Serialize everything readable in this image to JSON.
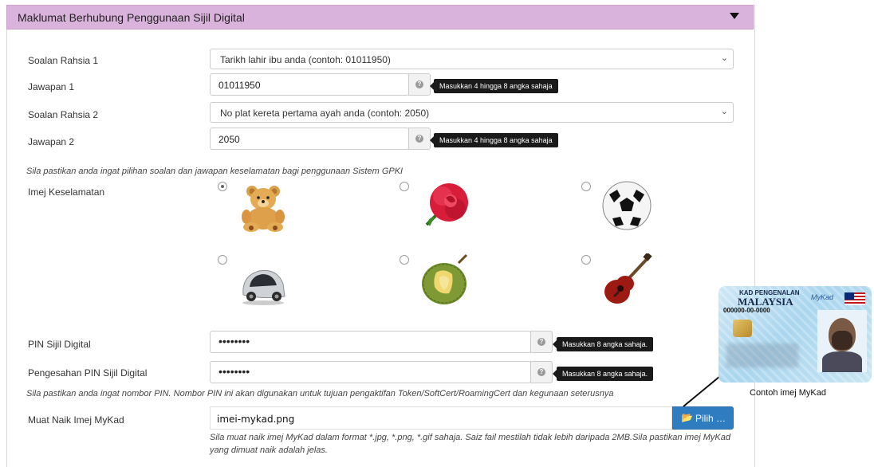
{
  "panel": {
    "title": "Maklumat Berhubung Penggunaan Sijil Digital",
    "caret_icon": "caret-down-icon"
  },
  "form": {
    "q1": {
      "label": "Soalan Rahsia 1",
      "value": "Tarikh lahir ibu anda (contoh: 01011950)"
    },
    "a1": {
      "label": "Jawapan 1",
      "value": "01011950",
      "tip": "Masukkan 4 hingga 8 angka sahaja"
    },
    "q2": {
      "label": "Soalan Rahsia 2",
      "value": "No plat kereta pertama ayah anda (contoh: 2050)"
    },
    "a2": {
      "label": "Jawapan 2",
      "value": "2050",
      "tip": "Masukkan 4 hingga 8 angka sahaja"
    },
    "security_note": "Sila pastikan anda ingat pilihan soalan dan jawapan keselamatan bagi penggunaan Sistem GPKI",
    "image_label": "Imej Keselamatan",
    "images": [
      {
        "icon": "teddy-bear-icon",
        "selected": true
      },
      {
        "icon": "rose-icon",
        "selected": false
      },
      {
        "icon": "soccer-ball-icon",
        "selected": false
      },
      {
        "icon": "car-icon",
        "selected": false
      },
      {
        "icon": "durian-icon",
        "selected": false
      },
      {
        "icon": "guitar-icon",
        "selected": false
      }
    ],
    "pin": {
      "label": "PIN Sijil Digital",
      "value": "••••••••",
      "tip": "Masukkan 8 angka sahaja."
    },
    "pin_confirm": {
      "label": "Pengesahan PIN Sijil Digital",
      "value": "••••••••",
      "tip": "Masukkan 8 angka sahaja."
    },
    "pin_note": "Sila pastikan anda ingat nombor PIN. Nombor PIN ini akan digunakan untuk tujuan pengaktifan Token/SoftCert/RoamingCert dan kegunaan seterusnya",
    "upload": {
      "label": "Muat Naik Imej MyKad",
      "filename": "imei-mykad.png",
      "button": "Pilih …",
      "note_line1": "Sila muat naik imej MyKad dalam format *.jpg, *.png, *.gif sahaja. Saiz fail mestilah tidak lebih daripada 2MB.Sila pastikan imej MyKad",
      "note_line2": "yang dimuat naik adalah jelas."
    }
  },
  "mykad_sample": {
    "header": "KAD PENGENALAN",
    "country": "MALAYSIA",
    "number": "000000-00-0000",
    "brand": "MyKad",
    "caption": "Contoh imej MyKad"
  }
}
